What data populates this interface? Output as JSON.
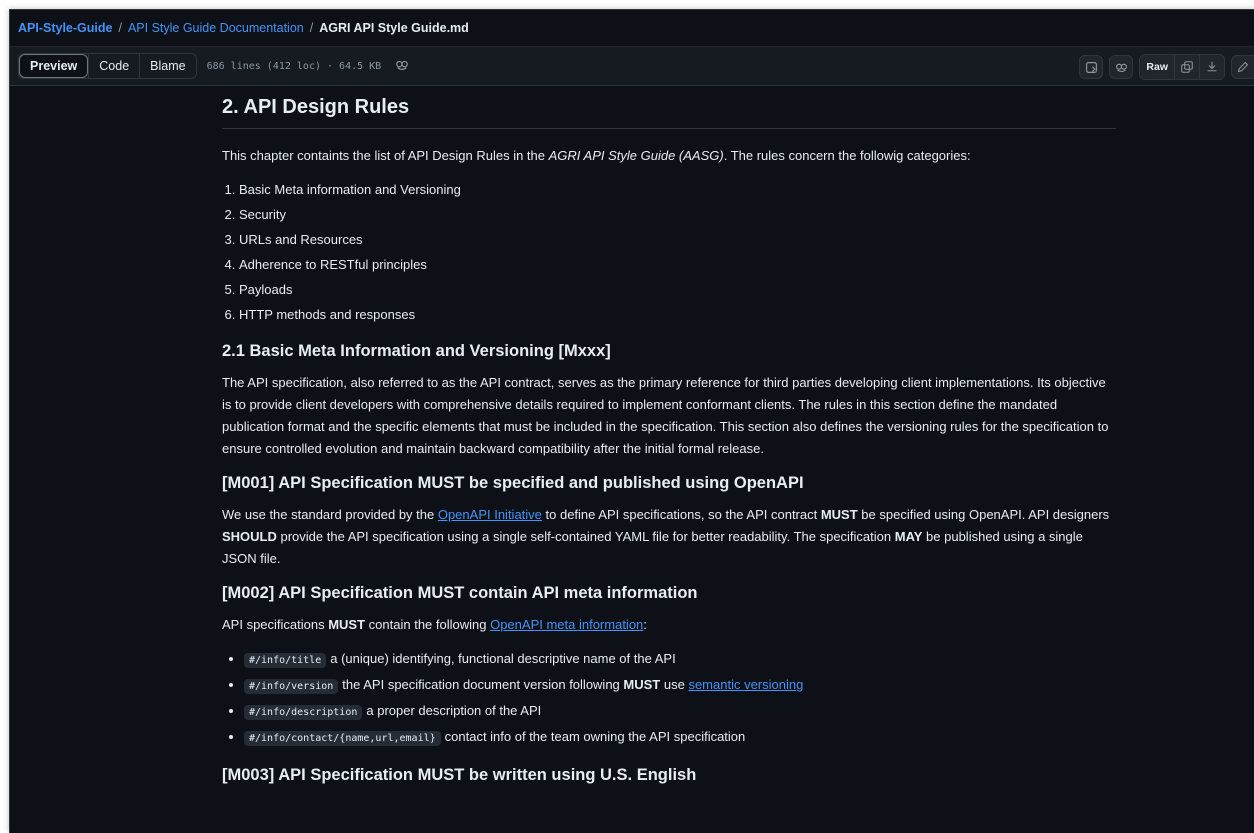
{
  "breadcrumb": {
    "repo": "API-Style-Guide",
    "sep": "/",
    "folder": "API Style Guide Documentation",
    "file": "AGRI API Style Guide.md"
  },
  "toolbar": {
    "tabs": [
      "Preview",
      "Code",
      "Blame"
    ],
    "file_info": "686 lines (412 loc) · 64.5 KB",
    "raw_label": "Raw"
  },
  "doc": {
    "h2": "2. API Design Rules",
    "intro": {
      "before": "This chapter containts the list of API Design Rules in the ",
      "italic": "AGRI API Style Guide (AASG)",
      "after": ". The rules concern the followig categories:"
    },
    "categories": [
      "Basic Meta information and Versioning",
      "Security",
      "URLs and Resources",
      "Adherence to RESTful principles",
      "Payloads",
      "HTTP methods and responses"
    ],
    "s21": {
      "title": "2.1 Basic Meta Information and Versioning [Mxxx]",
      "body": "The API specification, also referred to as the API contract, serves as the primary reference for third parties developing client implementations. Its objective is to provide client developers with comprehensive details required to implement conformant clients. The rules in this section define the mandated publication format and the specific elements that must be included in the specification. This section also defines the versioning rules for the specification to ensure controlled evolution and maintain backward compatibility after the initial formal release."
    },
    "m001": {
      "title": "[M001] API Specification MUST be specified and published using OpenAPI",
      "t1": "We use the standard provided by the ",
      "link": "OpenAPI Initiative",
      "t2": " to define API specifications, so the API contract ",
      "must": "MUST",
      "t3": " be specified using OpenAPI. API designers ",
      "should": "SHOULD",
      "t4": " provide the API specification using a single self-contained YAML file for better readability. The specification ",
      "may": "MAY",
      "t5": " be published using a single JSON file."
    },
    "m002": {
      "title": "[M002] API Specification MUST contain API meta information",
      "t1": "API specifications ",
      "must": "MUST",
      "t2": " contain the following ",
      "link": "OpenAPI meta information",
      "t3": ":",
      "items": [
        {
          "code": "#/info/title",
          "text": "a (unique) identifying, functional descriptive name of the API"
        },
        {
          "code": "#/info/version",
          "text": "the API specification document version following ",
          "bold": "MUST",
          "text2": " use ",
          "link": "semantic versioning"
        },
        {
          "code": "#/info/description",
          "text": "a proper description of the API"
        },
        {
          "code": "#/info/contact/{name,url,email}",
          "text": "contact info of the team owning the API specification"
        }
      ]
    },
    "m003": {
      "title": "[M003] API Specification MUST be written using U.S. English"
    }
  }
}
